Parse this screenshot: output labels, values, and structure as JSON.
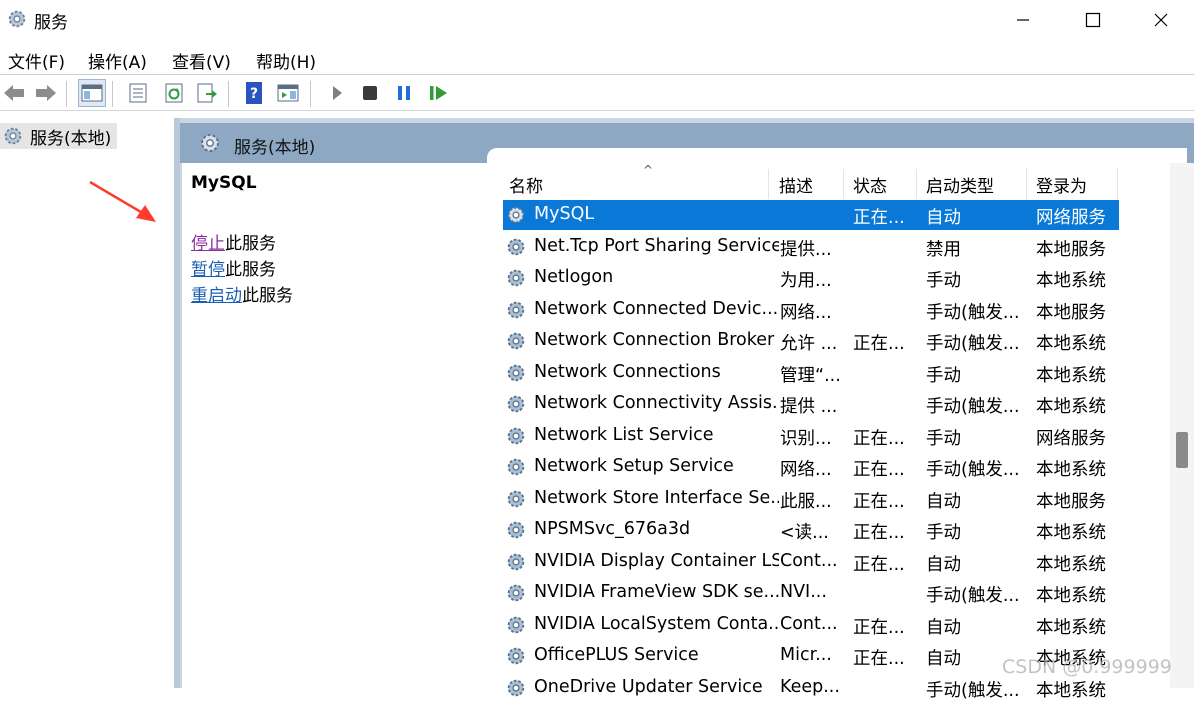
{
  "window": {
    "title": "服务",
    "icon": "gear-icon",
    "controls": [
      "minimize-icon",
      "maximize-icon",
      "close-icon"
    ]
  },
  "menu": [
    "文件(F)",
    "操作(A)",
    "查看(V)",
    "帮助(H)"
  ],
  "toolbar": {
    "buttons": [
      "back-arrow-icon",
      "forward-arrow-icon",
      "console-tree-icon",
      "properties-icon",
      "refresh-icon",
      "export-list-icon",
      "help-icon",
      "action-pane-icon",
      "start-service-icon",
      "stop-service-icon",
      "pause-service-icon",
      "resume-service-icon"
    ]
  },
  "tree": {
    "root_label": "服务(本地)"
  },
  "pane": {
    "header_label": "服务(本地)"
  },
  "description": {
    "service_name": "MySQL",
    "actions": [
      {
        "link": "停止",
        "suffix": "此服务"
      },
      {
        "link": "暂停",
        "suffix": "此服务"
      },
      {
        "link": "重启动",
        "suffix": "此服务"
      }
    ]
  },
  "list": {
    "sort_indicator": "^",
    "columns": [
      "名称",
      "描述",
      "状态",
      "启动类型",
      "登录为"
    ],
    "rows": [
      {
        "name": "MySQL",
        "desc": "",
        "status": "正在...",
        "startup": "自动",
        "logon": "网络服务",
        "selected": true
      },
      {
        "name": "Net.Tcp Port Sharing Service",
        "desc": "提供...",
        "status": "",
        "startup": "禁用",
        "logon": "本地服务"
      },
      {
        "name": "Netlogon",
        "desc": "为用...",
        "status": "",
        "startup": "手动",
        "logon": "本地系统"
      },
      {
        "name": "Network Connected Devic...",
        "desc": "网络...",
        "status": "",
        "startup": "手动(触发...",
        "logon": "本地服务"
      },
      {
        "name": "Network Connection Broker",
        "desc": "允许 ...",
        "status": "正在...",
        "startup": "手动(触发...",
        "logon": "本地系统"
      },
      {
        "name": "Network Connections",
        "desc": "管理“...",
        "status": "",
        "startup": "手动",
        "logon": "本地系统"
      },
      {
        "name": "Network Connectivity Assis...",
        "desc": "提供 ...",
        "status": "",
        "startup": "手动(触发...",
        "logon": "本地系统"
      },
      {
        "name": "Network List Service",
        "desc": "识别...",
        "status": "正在...",
        "startup": "手动",
        "logon": "网络服务"
      },
      {
        "name": "Network Setup Service",
        "desc": "网络...",
        "status": "正在...",
        "startup": "手动(触发...",
        "logon": "本地系统"
      },
      {
        "name": "Network Store Interface Se...",
        "desc": "此服...",
        "status": "正在...",
        "startup": "自动",
        "logon": "本地服务"
      },
      {
        "name": "NPSMSvc_676a3d",
        "desc": "<读...",
        "status": "正在...",
        "startup": "手动",
        "logon": "本地系统"
      },
      {
        "name": "NVIDIA Display Container LS",
        "desc": "Cont...",
        "status": "正在...",
        "startup": "自动",
        "logon": "本地系统"
      },
      {
        "name": "NVIDIA FrameView SDK se...",
        "desc": "NVI...",
        "status": "",
        "startup": "手动(触发...",
        "logon": "本地系统"
      },
      {
        "name": "NVIDIA LocalSystem Conta...",
        "desc": "Cont...",
        "status": "正在...",
        "startup": "自动",
        "logon": "本地系统"
      },
      {
        "name": "OfficePLUS Service",
        "desc": "Micr...",
        "status": "正在...",
        "startup": "自动",
        "logon": "本地系统"
      },
      {
        "name": "OneDrive Updater Service",
        "desc": "Keep...",
        "status": "",
        "startup": "手动(触发...",
        "logon": "本地系统"
      }
    ]
  },
  "watermark": "CSDN @0.999999",
  "colors": {
    "selection": "#0a78d7",
    "pane_header": "#8ea8c3",
    "link": "#1a5fb4",
    "visited_link": "#8a2da0",
    "annotation_arrow": "#ff3b30"
  }
}
